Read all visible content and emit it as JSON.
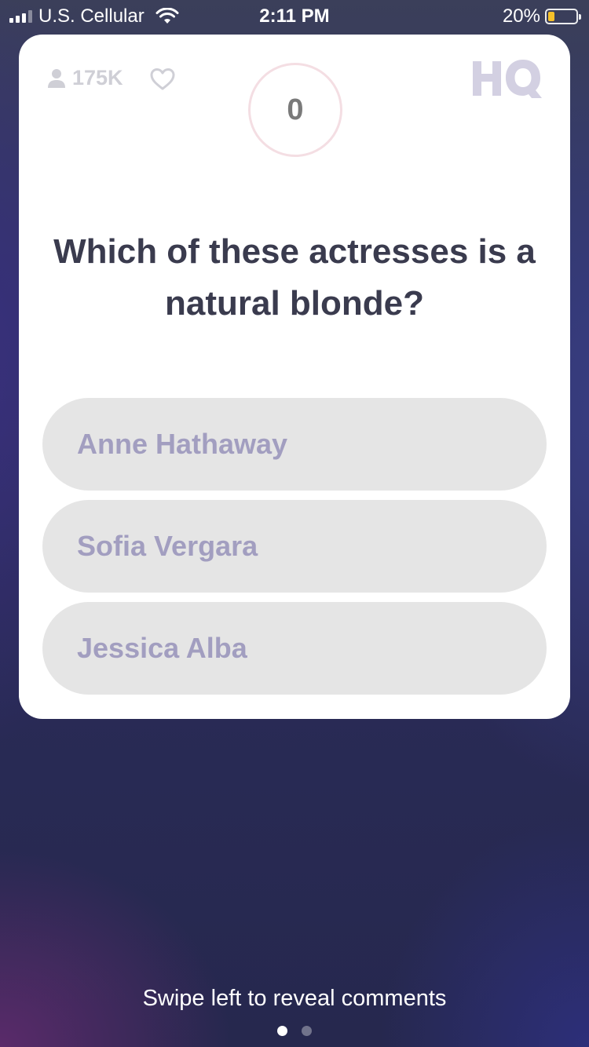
{
  "status_bar": {
    "carrier": "U.S. Cellular",
    "time": "2:11 PM",
    "battery_percent": "20%",
    "battery_level": 0.2,
    "signal_bars": 3,
    "signal_max": 4
  },
  "game": {
    "viewer_count": "175K",
    "timer": "0",
    "logo": "HQ",
    "question": "Which of these actresses is a natural blonde?",
    "answers": [
      {
        "label": "Anne Hathaway"
      },
      {
        "label": "Sofia Vergara"
      },
      {
        "label": "Jessica Alba"
      }
    ]
  },
  "footer": {
    "hint": "Swipe left to reveal comments",
    "page_count": 2,
    "active_page": 1
  },
  "icons": {
    "signal": "cellular-signal-icon",
    "wifi": "wifi-icon",
    "battery": "battery-icon",
    "viewers": "person-icon",
    "like": "heart-icon",
    "logo": "hq-logo"
  },
  "colors": {
    "card_background": "#ffffff",
    "question_text": "#3a3b4e",
    "answer_background": "#e5e5e5",
    "answer_text": "#a29ec0",
    "timer_ring": "#f4dee3",
    "battery_fill": "#f5c02a"
  }
}
